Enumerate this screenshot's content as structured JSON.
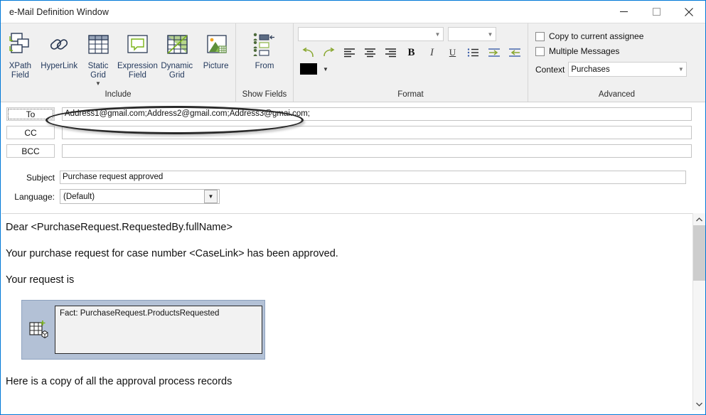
{
  "window": {
    "title": "e-Mail Definition Window",
    "controls": [
      {
        "name": "minimize",
        "glyph": "minimize-icon"
      },
      {
        "name": "maximize",
        "glyph": "maximize-icon"
      },
      {
        "name": "close",
        "glyph": "close-icon"
      }
    ],
    "accent_color": "#0078d7"
  },
  "ribbon": {
    "groups": [
      {
        "title": "Include",
        "items": [
          {
            "label": "XPath\nField",
            "label_line1": "XPath",
            "label_line2": "Field",
            "icon": "xpath-field-icon",
            "has_caret": false
          },
          {
            "label": "HyperLink",
            "label_line1": "HyperLink",
            "label_line2": "",
            "icon": "hyperlink-icon",
            "has_caret": false
          },
          {
            "label": "Static Grid",
            "label_line1": "Static",
            "label_line2": "Grid",
            "icon": "static-grid-icon",
            "has_caret": true
          },
          {
            "label": "Expression Field",
            "label_line1": "Expression",
            "label_line2": "Field",
            "icon": "expression-field-icon",
            "has_caret": false
          },
          {
            "label": "Dynamic Grid",
            "label_line1": "Dynamic",
            "label_line2": "Grid",
            "icon": "dynamic-grid-icon",
            "has_caret": false
          },
          {
            "label": "Picture",
            "label_line1": "Picture",
            "label_line2": "",
            "icon": "picture-icon",
            "has_caret": false
          }
        ]
      },
      {
        "title": "Show Fields",
        "items": [
          {
            "label": "From",
            "label_line1": "From",
            "label_line2": "",
            "icon": "from-icon",
            "has_caret": false
          }
        ]
      },
      {
        "title": "Format",
        "font_name_value": "",
        "font_name_placeholder": "",
        "font_size_value": "",
        "font_size_placeholder": "",
        "buttons": [
          {
            "name": "undo-button",
            "icon": "undo-icon"
          },
          {
            "name": "redo-button",
            "icon": "redo-icon"
          },
          {
            "name": "align-left-button",
            "icon": "align-left-icon"
          },
          {
            "name": "align-center-button",
            "icon": "align-center-icon"
          },
          {
            "name": "align-right-button",
            "icon": "align-right-icon"
          },
          {
            "name": "bold-button",
            "icon": "bold-icon",
            "text": "B"
          },
          {
            "name": "italic-button",
            "icon": "italic-icon",
            "text": "I"
          },
          {
            "name": "underline-button",
            "icon": "underline-icon",
            "text": "U"
          },
          {
            "name": "bullet-list-button",
            "icon": "bullet-list-icon"
          },
          {
            "name": "increase-indent-button",
            "icon": "increase-indent-icon"
          },
          {
            "name": "decrease-indent-button",
            "icon": "decrease-indent-icon"
          }
        ],
        "color_swatch": "#000000"
      },
      {
        "title": "Advanced",
        "checkboxes": [
          {
            "label": "Copy to current assignee",
            "checked": false
          },
          {
            "label": "Multiple Messages",
            "checked": false
          }
        ],
        "context_label": "Context",
        "context_value": "Purchases"
      }
    ]
  },
  "fields": {
    "to": {
      "button_label": "To",
      "value": "Address1@gmail.com;Address2@gmail.com;Address3@gmai.com;",
      "placeholder": ""
    },
    "cc": {
      "button_label": "CC",
      "value": "",
      "placeholder": ""
    },
    "bcc": {
      "button_label": "BCC",
      "value": "",
      "placeholder": ""
    },
    "subject": {
      "label": "Subject",
      "value": "Purchase request approved",
      "placeholder": ""
    },
    "language": {
      "label": "Language:",
      "value": "(Default)"
    }
  },
  "body": {
    "paragraphs": [
      "Dear <PurchaseRequest.RequestedBy.fullName>",
      "Your purchase request for case number <CaseLink> has been approved.",
      "Your request is"
    ],
    "grid_widget": {
      "icon": "grid-fact-icon",
      "text": "Fact: PurchaseRequest.ProductsRequested",
      "background": "#b3c1d6"
    },
    "closing_paragraph": "Here is a copy of all the approval process records"
  },
  "scrollbar": {
    "up_icon": "chevron-up-icon",
    "down_icon": "chevron-down-icon"
  }
}
